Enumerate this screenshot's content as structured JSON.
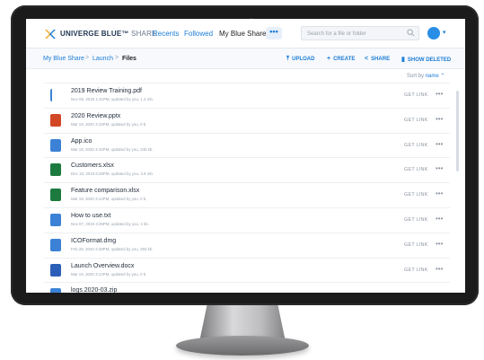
{
  "brand": {
    "name": "UNIVERGE BLUE",
    "tm": "™",
    "product": "SHARE"
  },
  "nav": {
    "recents": "Recents",
    "followed": "Followed",
    "my_blue_share": "My Blue Share",
    "more": "•••"
  },
  "search": {
    "placeholder": "Search for a file or folder"
  },
  "breadcrumb": {
    "root": "My Blue Share",
    "mid": "Launch",
    "current": "Files",
    "sep": ">"
  },
  "actions": {
    "upload": "UPLOAD",
    "create": "CREATE",
    "share": "SHARE",
    "show_deleted": "SHOW DELETED"
  },
  "sort": {
    "label": "Sort by",
    "value": "name"
  },
  "files": [
    {
      "name": "2019 Review Training.pdf",
      "meta": "Nov 06, 2019 1:41PM, updated by you, 1.4 mb.",
      "type": "pdf",
      "color": "#3b82d6"
    },
    {
      "name": "2020 Review.pptx",
      "meta": "Mar 19, 2020 3:15PM, updated by you, 0 b.",
      "type": "pptx",
      "color": "#d24726"
    },
    {
      "name": "App.ico",
      "meta": "Mar 19, 2020 4:44PM, updated by you, 345 kb.",
      "type": "doc",
      "color": "#3b82d6"
    },
    {
      "name": "Customers.xlsx",
      "meta": "Dec 19, 2019 6:26PM, updated by you, 4.9 mb.",
      "type": "xlsx",
      "color": "#1d7a3f"
    },
    {
      "name": "Feature comparison.xlsx",
      "meta": "Mar 19, 2020 3:14PM, updated by you, 0 b.",
      "type": "xlsx",
      "color": "#1d7a3f"
    },
    {
      "name": "How to use.txt",
      "meta": "Nov 07, 2019 4:36PM, updated by you, 1 kb.",
      "type": "doc",
      "color": "#3b82d6"
    },
    {
      "name": "ICOFormat.dmg",
      "meta": "Feb 28, 2020 2:28PM, updated by you, 303 kb.",
      "type": "doc",
      "color": "#3b82d6"
    },
    {
      "name": "Launch Overview.docx",
      "meta": "Mar 19, 2020 3:14PM, updated by you, 0 b.",
      "type": "docx",
      "color": "#2b5fb7"
    },
    {
      "name": "logs 2020-03.zip",
      "meta": "",
      "type": "zip",
      "color": "#3b82d6"
    }
  ],
  "row_action": {
    "get_link": "GET LINK",
    "more": "•••"
  },
  "colors": {
    "accent": "#1b7cd6",
    "brand_orange": "#f5a623",
    "brand_blue": "#1f3553"
  }
}
